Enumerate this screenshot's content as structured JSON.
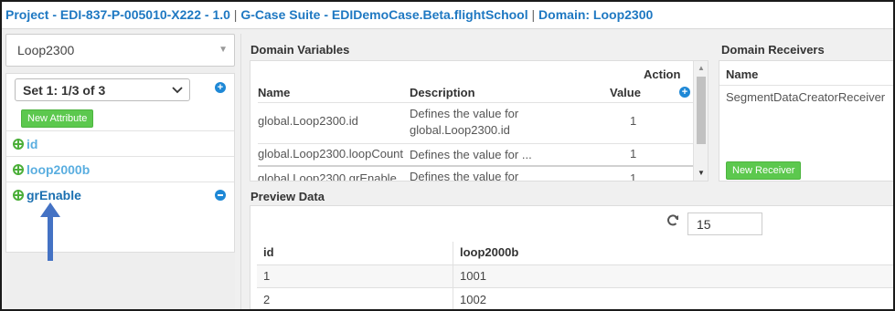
{
  "header": {
    "project": "Project - EDI-837-P-005010-X222 - 1.0",
    "suite": "G-Case Suite - EDIDemoCase.Beta.flightSchool",
    "domain": "Domain: Loop2300",
    "separator": "|"
  },
  "left": {
    "domain_select": "Loop2300",
    "set_select": "Set 1: 1/3 of 3",
    "new_attribute_label": "New Attribute",
    "attributes": [
      {
        "label": "id"
      },
      {
        "label": "loop2000b"
      },
      {
        "label": "grEnable",
        "selected": true
      }
    ]
  },
  "domain_variables": {
    "title": "Domain Variables",
    "columns": {
      "name": "Name",
      "description": "Description",
      "value": "Value",
      "action": "Action"
    },
    "rows": [
      {
        "name": "global.Loop2300.id",
        "description_line1": "Defines the value for",
        "description_line2": "global.Loop2300.id",
        "value": "1"
      },
      {
        "name": "global.Loop2300.loopCount",
        "description_line1": "Defines the value for ...",
        "value": "1"
      },
      {
        "name": "global.Loop2300.grEnable",
        "description_line1": "Defines the value for",
        "value": "1"
      }
    ]
  },
  "domain_receivers": {
    "title": "Domain Receivers",
    "column_name": "Name",
    "rows": [
      "SegmentDataCreatorReceiver"
    ],
    "new_receiver_label": "New Receiver"
  },
  "preview": {
    "title": "Preview Data",
    "row_count": "15",
    "columns": [
      "id",
      "loop2000b"
    ],
    "rows": [
      [
        "1",
        "1001"
      ],
      [
        "2",
        "1002"
      ]
    ]
  },
  "colors": {
    "accent": "#1e78c2",
    "green_button": "#5cc84e",
    "attribute_icon": "#4caf3a",
    "arrow": "#4472c4"
  }
}
